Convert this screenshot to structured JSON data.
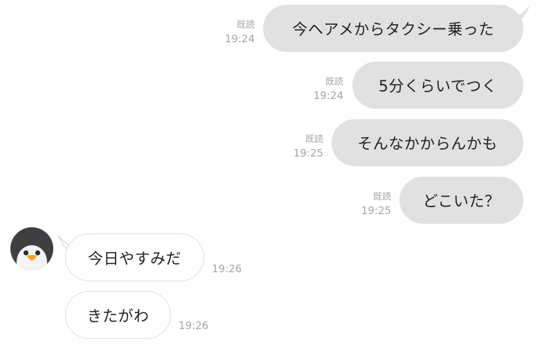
{
  "messages": {
    "outgoing": [
      {
        "text": "今ヘアメからタクシー乗った",
        "read": "既読",
        "time": "19:24"
      },
      {
        "text": "5分くらいでつく",
        "read": "既読",
        "time": "19:24"
      },
      {
        "text": "そんなかからんかも",
        "read": "既読",
        "time": "19:25"
      },
      {
        "text": "どこいた？",
        "read": "既読",
        "time": "19:25"
      }
    ],
    "incoming": [
      {
        "text": "今日やすみだ",
        "time": "19:26"
      },
      {
        "text": "きたがわ",
        "time": "19:26"
      }
    ]
  },
  "contact": {
    "avatar_icon": "penguin-avatar-icon"
  },
  "colors": {
    "outgoing_bubble": "#e1e1e1",
    "incoming_bubble": "#ffffff",
    "incoming_border": "#dddddd",
    "meta_text": "#a6a6a6",
    "message_text": "#222222"
  }
}
